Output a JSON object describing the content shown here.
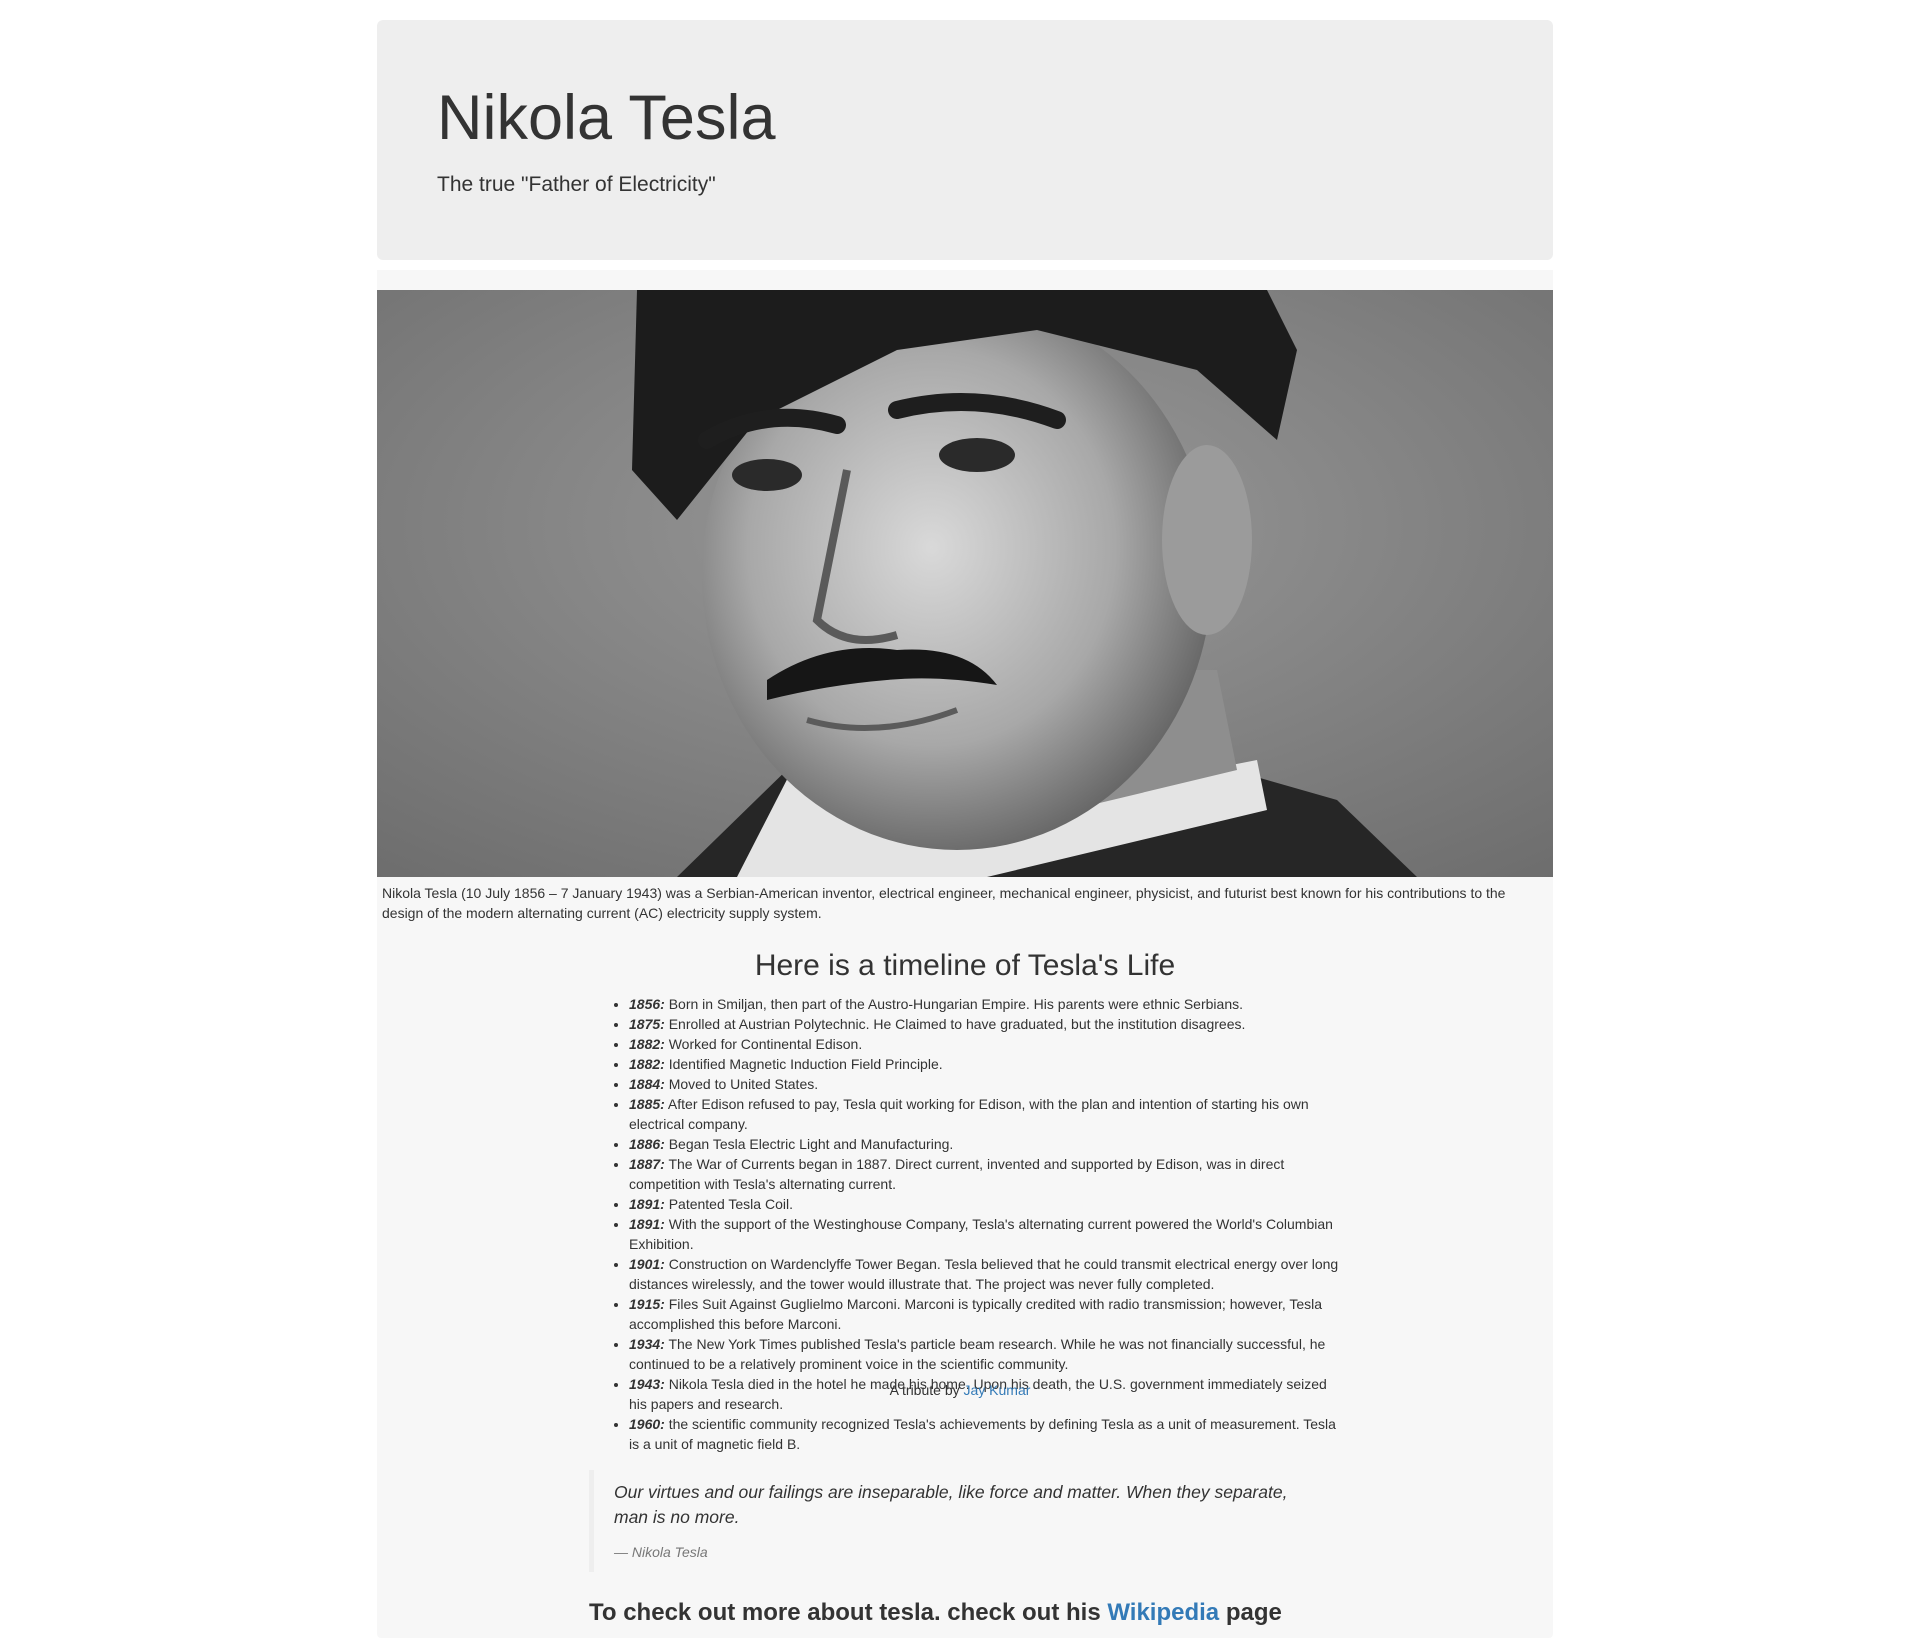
{
  "header": {
    "title": "Nikola Tesla",
    "subtitle": "The true \"Father of Electricity\""
  },
  "portrait": {
    "alt": "Nikola Tesla"
  },
  "caption": "Nikola Tesla (10 July 1856 – 7 January 1943) was a Serbian-American inventor, electrical engineer, mechanical engineer, physicist, and futurist best known for his contributions to the design of the modern alternating current (AC) electricity supply system.",
  "timeline": {
    "title": "Here is a timeline of Tesla's Life",
    "items": [
      {
        "year": "1856:",
        "text": " Born in Smiljan, then part of the Austro-Hungarian Empire. His parents were ethnic Serbians."
      },
      {
        "year": "1875:",
        "text": " Enrolled at Austrian Polytechnic. He Claimed to have graduated, but the institution disagrees."
      },
      {
        "year": "1882:",
        "text": " Worked for Continental Edison."
      },
      {
        "year": "1882:",
        "text": " Identified Magnetic Induction Field Principle."
      },
      {
        "year": "1884:",
        "text": " Moved to United States."
      },
      {
        "year": "1885:",
        "text": " After Edison refused to pay, Tesla quit working for Edison, with the plan and intention of starting his own electrical company."
      },
      {
        "year": "1886:",
        "text": " Began Tesla Electric Light and Manufacturing."
      },
      {
        "year": "1887:",
        "text": " The War of Currents began in 1887. Direct current, invented and supported by Edison, was in direct competition with Tesla's alternating current."
      },
      {
        "year": "1891:",
        "text": " Patented Tesla Coil."
      },
      {
        "year": "1891:",
        "text": " With the support of the Westinghouse Company, Tesla's alternating current powered the World's Columbian Exhibition."
      },
      {
        "year": "1901:",
        "text": " Construction on Wardenclyffe Tower Began. Tesla believed that he could transmit electrical energy over long distances wirelessly, and the tower would illustrate that. The project was never fully completed."
      },
      {
        "year": "1915:",
        "text": " Files Suit Against Guglielmo Marconi. Marconi is typically credited with radio transmission; however, Tesla accomplished this before Marconi."
      },
      {
        "year": "1934:",
        "text": " The New York Times published Tesla's particle beam research. While he was not financially successful, he continued to be a relatively prominent voice in the scientific community."
      },
      {
        "year": "1943:",
        "text": " Nikola Tesla died in the hotel he made his home. Upon his death, the U.S. government immediately seized his papers and research."
      },
      {
        "year": "1960:",
        "text": " the scientific community recognized Tesla's achievements by defining Tesla as a unit of measurement. Tesla is a unit of magnetic field B."
      }
    ]
  },
  "quote": {
    "text": "Our virtues and our failings are inseparable, like force and matter. When they separate, man is no more.",
    "attribution": "— Nikola Tesla"
  },
  "more": {
    "prefix": "To check out more about tesla. check out his ",
    "link_label": "Wikipedia",
    "suffix": " page"
  },
  "footer": {
    "prefix": "A tribute by ",
    "link_label": "Jay Kumar"
  },
  "colors": {
    "link": "#337ab7",
    "jumbotron_bg": "#eeeeee",
    "main_bg": "#f7f7f7",
    "text": "#333333"
  }
}
